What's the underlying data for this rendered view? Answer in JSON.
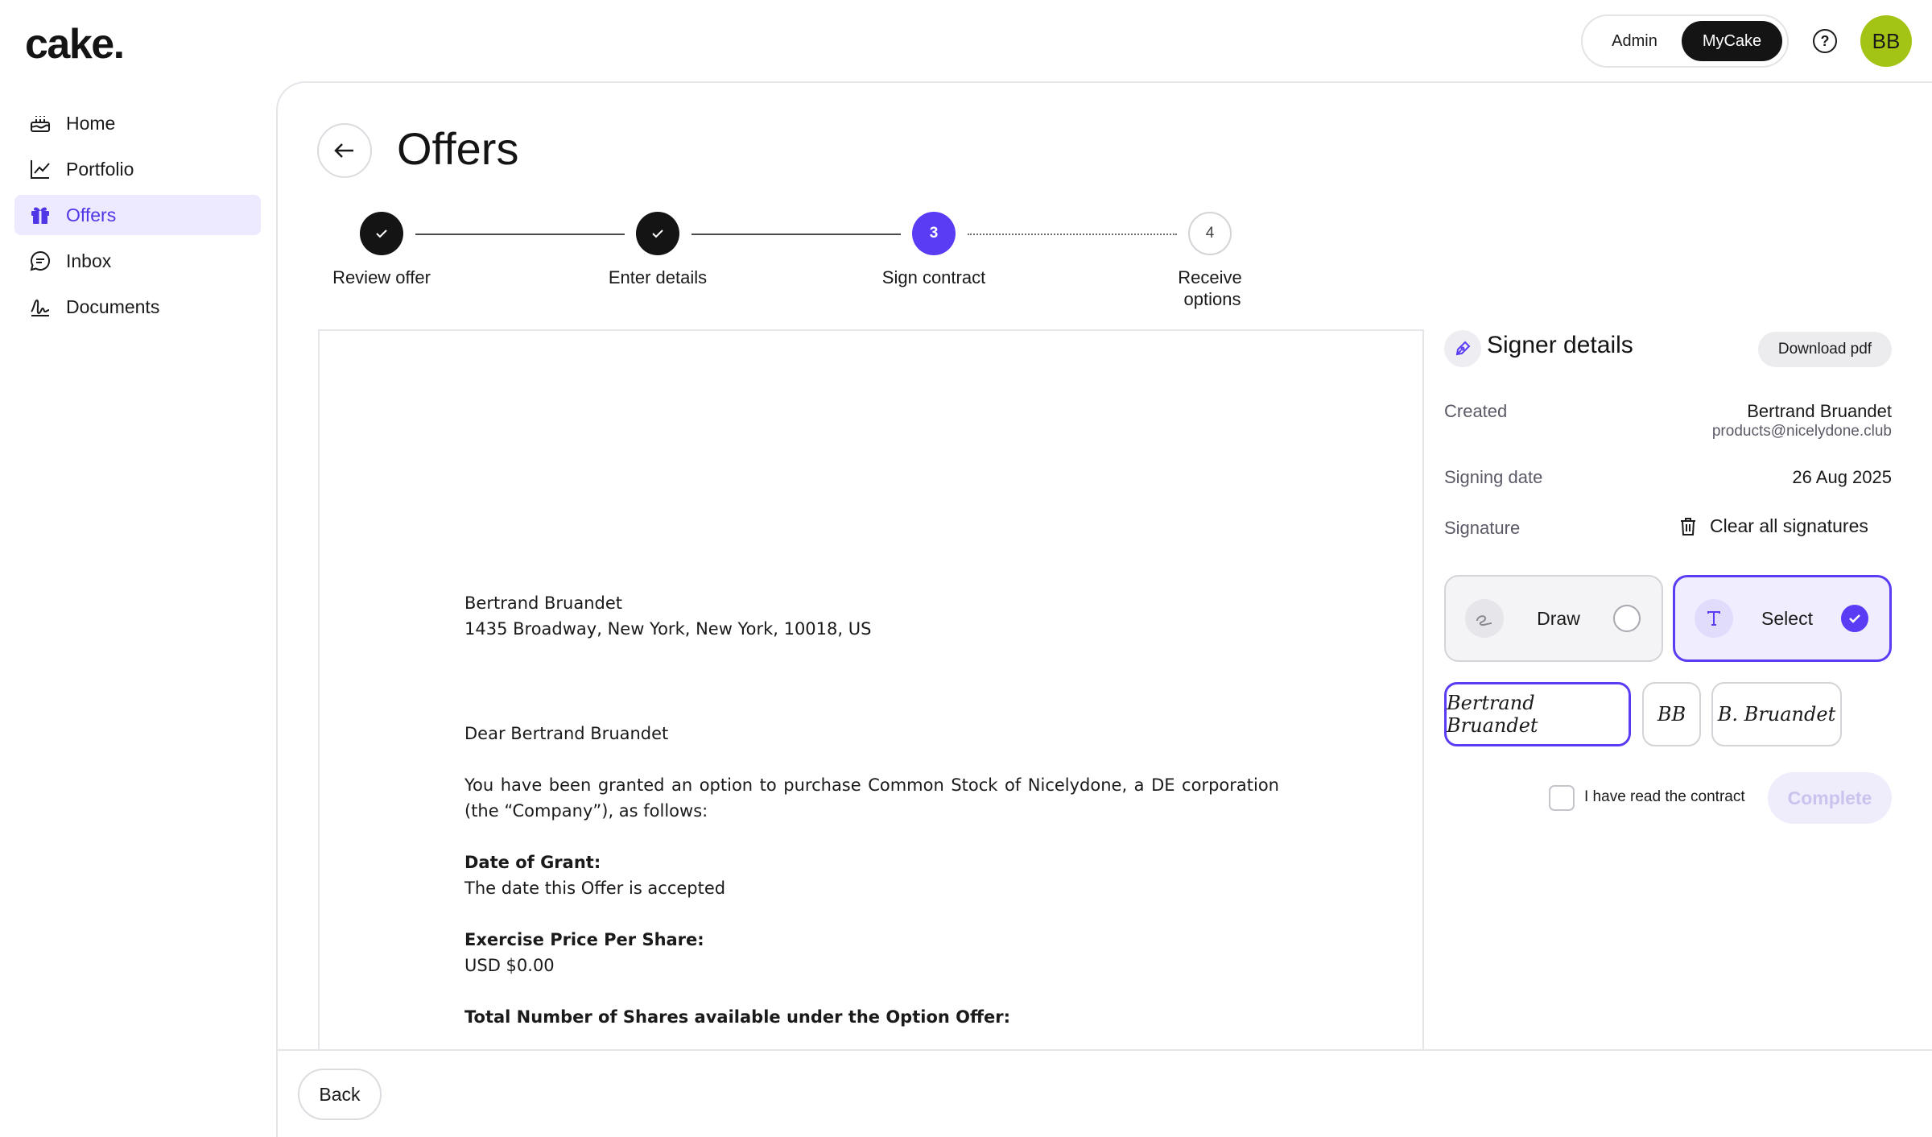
{
  "header": {
    "logo": "cake.",
    "roles": [
      "Admin",
      "MyCake"
    ],
    "active_role": "MyCake",
    "help_icon": "question-circle-icon",
    "avatar_initials": "BB",
    "avatar_color": "#a3c414"
  },
  "sidebar": {
    "items": [
      {
        "label": "Home",
        "icon": "cake-icon",
        "active": false
      },
      {
        "label": "Portfolio",
        "icon": "chart-line-icon",
        "active": false
      },
      {
        "label": "Offers",
        "icon": "gift-icon",
        "active": true
      },
      {
        "label": "Inbox",
        "icon": "chat-bubble-icon",
        "active": false
      },
      {
        "label": "Documents",
        "icon": "signature-icon",
        "active": false
      }
    ]
  },
  "page": {
    "title": "Offers"
  },
  "stepper": {
    "current_step": 3,
    "steps": [
      {
        "label": "Review offer",
        "state": "done",
        "number": "1"
      },
      {
        "label": "Enter details",
        "state": "done",
        "number": "2"
      },
      {
        "label": "Sign contract",
        "state": "current",
        "number": "3"
      },
      {
        "label": "Receive options",
        "state": "todo",
        "number": "4",
        "line1": "Receive",
        "line2": "options"
      }
    ]
  },
  "document": {
    "recipient_name": "Bertrand Bruandet",
    "recipient_address": "1435 Broadway, New York, New York, 10018, US",
    "salutation": "Dear Bertrand Bruandet",
    "intro": "You have been granted an option to purchase Common Stock of Nicelydone, a DE corporation (the “Company”), as follows:",
    "date_of_grant_label": "Date of Grant:",
    "date_of_grant_value": "The date this Offer is accepted",
    "exercise_price_label": "Exercise Price Per Share:",
    "exercise_price_value": "USD $0.00",
    "total_shares_label": "Total Number of Shares available under the Option Offer:"
  },
  "signer": {
    "title": "Signer details",
    "download_label": "Download pdf",
    "created_label": "Created",
    "created_name": "Bertrand Bruandet",
    "created_email": "products@nicelydone.club",
    "signing_date_label": "Signing date",
    "signing_date_value": "26 Aug 2025",
    "signature_label": "Signature",
    "clear_label": "Clear all signatures",
    "modes": [
      {
        "label": "Draw",
        "icon": "draw-squiggle-icon",
        "selected": false
      },
      {
        "label": "Select",
        "icon": "text-type-icon",
        "selected": true
      }
    ],
    "signature_options": [
      "Bertrand Bruandet",
      "BB",
      "B. Bruandet"
    ],
    "selected_signature": "Bertrand Bruandet",
    "read_contract_label": "I have read the contract",
    "read_contract_checked": false,
    "complete_label": "Complete"
  },
  "footer": {
    "back_label": "Back"
  },
  "colors": {
    "accent": "#5b3cf5",
    "active_nav_bg": "#ede9fe",
    "dark": "#141414"
  }
}
